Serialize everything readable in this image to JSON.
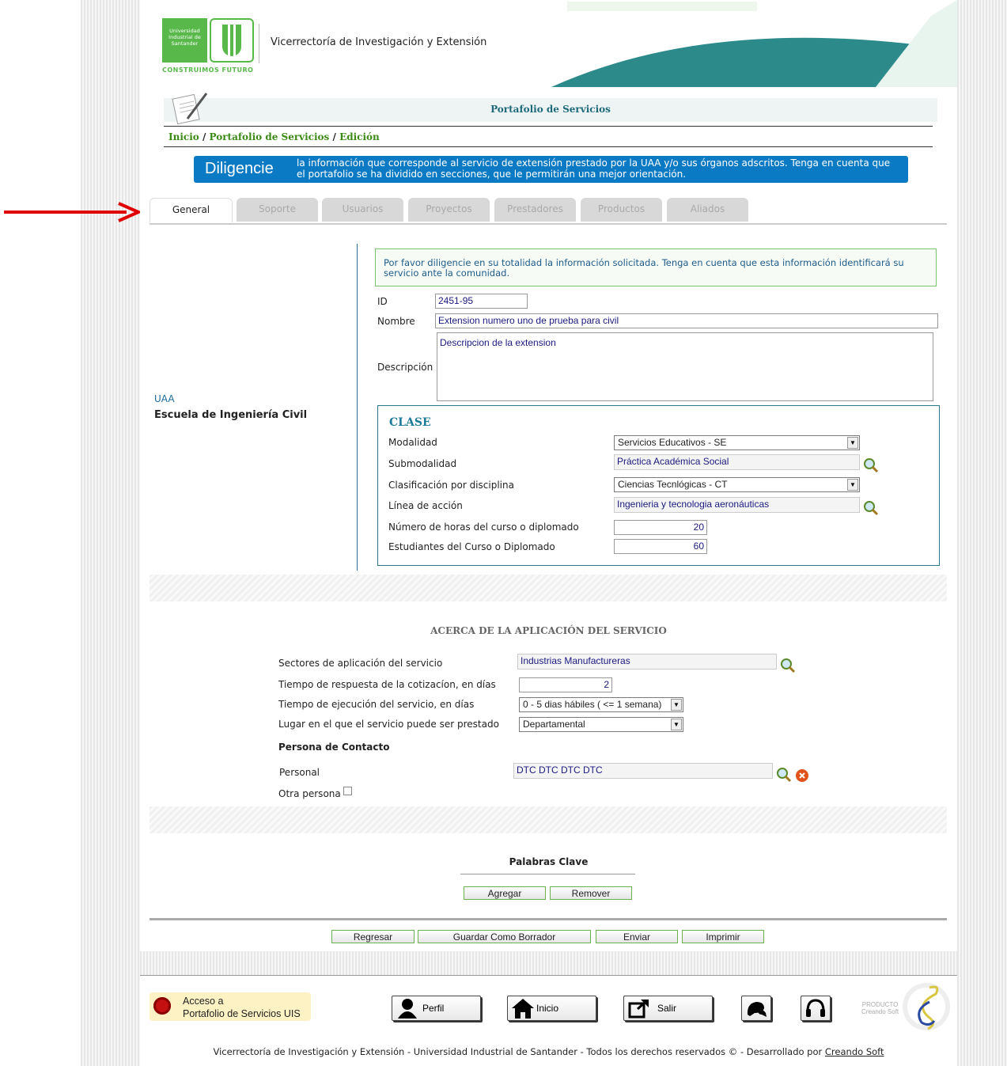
{
  "header": {
    "logo_text": "Universidad Industrial de Santander",
    "tagline": "CONSTRUIMOS FUTURO",
    "org": "Vicerrectoría de Investigación y Extensión"
  },
  "page_title": "Portafolio de Servicios",
  "breadcrumb": {
    "home": "Inicio",
    "sep1": " / ",
    "section": "Portafolio de Servicios",
    "sep2": " / ",
    "current": "Edición"
  },
  "banner": {
    "big": "Diligencie",
    "text": "la información que corresponde al servicio de extensión prestado por la UAA y/o sus órganos adscritos. Tenga en cuenta que el portafolio se ha dividido en secciones, que le permitirán una mejor orientación."
  },
  "tabs": [
    "General",
    "Soporte",
    "Usuarios",
    "Proyectos",
    "Prestadores",
    "Productos",
    "Aliados"
  ],
  "sidebar": {
    "unit_label": "UAA",
    "unit_name": "Escuela de Ingeniería Civil"
  },
  "general": {
    "note": "Por favor diligencie en su totalidad la información solicitada. Tenga en cuenta que esta información identificará su servicio ante la comunidad.",
    "id_label": "ID",
    "id_value": "2451-95",
    "nombre_label": "Nombre",
    "nombre_value": "Extension numero uno de prueba para civil",
    "descripcion_label": "Descripción",
    "descripcion_value": "Descripcion de la extension"
  },
  "clase": {
    "title": "CLASE",
    "modalidad_label": "Modalidad",
    "modalidad_value": "Servicios Educativos - SE",
    "submodalidad_label": "Submodalidad",
    "submodalidad_value": "Práctica Académica Social",
    "clasificacion_label": "Clasificación por disciplina",
    "clasificacion_value": "Ciencias Tecnlógicas - CT",
    "linea_label": "Línea de acción",
    "linea_value": "Ingenieria y tecnologia aeronáuticas",
    "horas_label": "Número de horas del curso o diplomado",
    "horas_value": "20",
    "estudiantes_label": "Estudiantes del Curso o Diplomado",
    "estudiantes_value": "60"
  },
  "aplicacion": {
    "title": "ACERCA DE LA APLICACIÓN DEL SERVICIO",
    "sectores_label": "Sectores de aplicación del servicio",
    "sectores_value": "Industrias Manufactureras",
    "tiempo_resp_label": "Tiempo de respuesta de la cotizacíon, en días",
    "tiempo_resp_value": "2",
    "tiempo_ejec_label": "Tiempo de ejecución del servicio, en días",
    "tiempo_ejec_value": "0 - 5 dias hábiles ( <= 1 semana)",
    "lugar_label": "Lugar en el que el servicio puede ser prestado",
    "lugar_value": "Departamental",
    "contacto_title": "Persona de Contacto",
    "personal_label": "Personal",
    "personal_value": "DTC DTC DTC DTC",
    "otra_label": "Otra persona"
  },
  "palabras": {
    "title": "Palabras Clave",
    "agregar": "Agregar",
    "remover": "Remover"
  },
  "actions": {
    "regresar": "Regresar",
    "guardar": "Guardar Como Borrador",
    "enviar": "Enviar",
    "imprimir": "Imprimir"
  },
  "footer": {
    "acceso": "Acceso a\nPortafolio de Servicios UIS",
    "perfil": "Perfil",
    "inicio": "Inicio",
    "salir": "Salir",
    "producto": "PRODUCTO\nCreando Soft",
    "copyright": "Vicerrectoría de Investigación y Extensión - Universidad Industrial de Santander - Todos los derechos reservados © - Desarrollado por ",
    "creando": "Creando Soft"
  },
  "colors": {
    "brand_green": "#58b94a",
    "banner_blue": "#0b7ac4",
    "teal": "#2d8a8a",
    "annotation_red": "#e00000"
  }
}
